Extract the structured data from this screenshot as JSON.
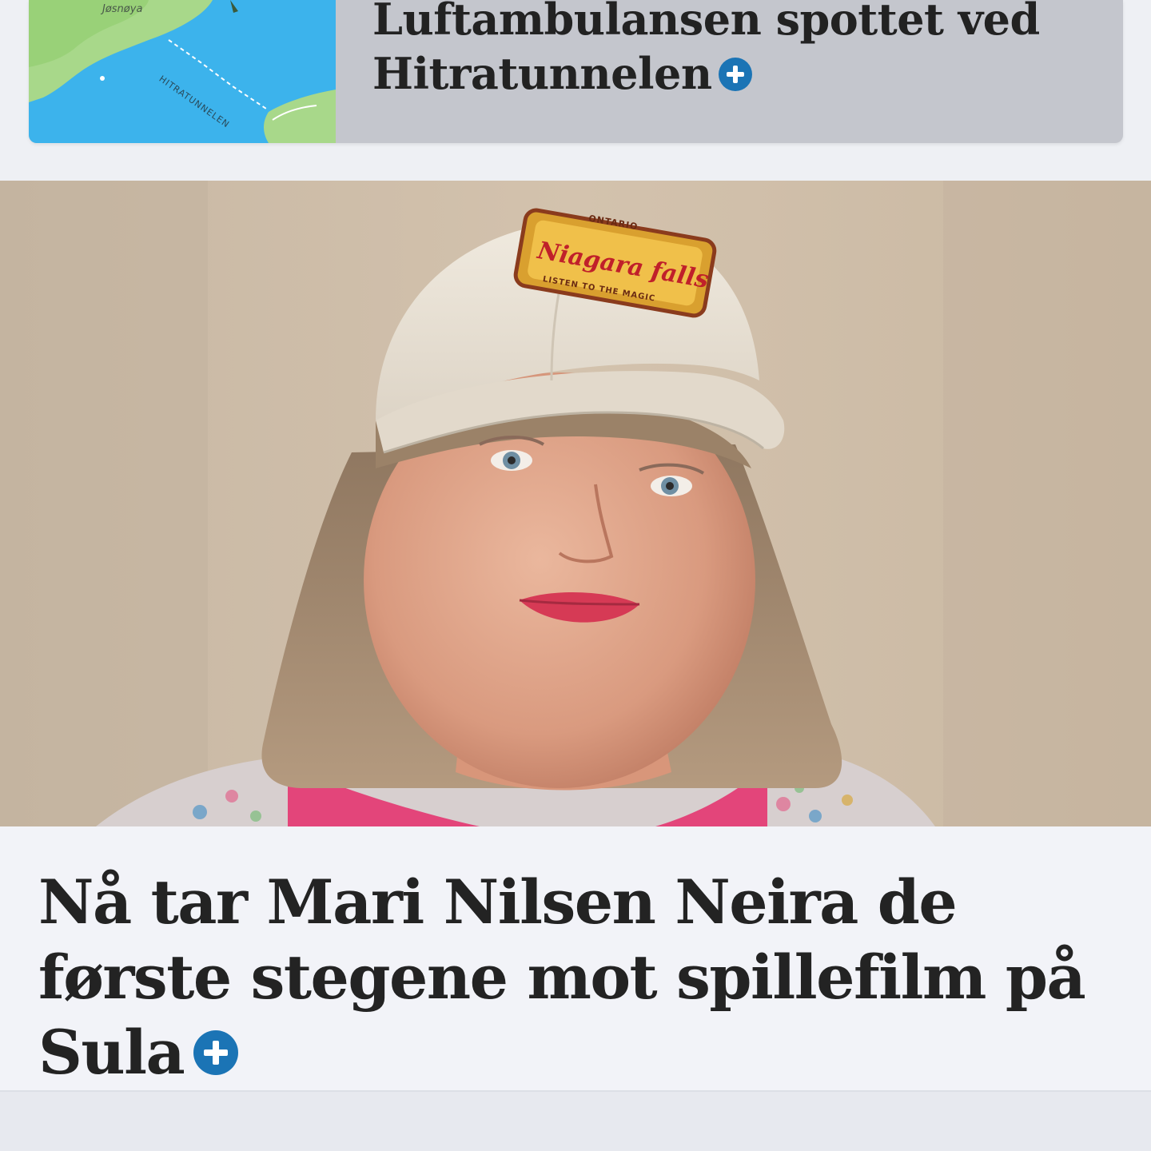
{
  "teaser": {
    "map": {
      "island_label": "Jøsnøya",
      "tunnel_label": "HITRATUNNELEN"
    },
    "headline": "Luftambulansen spottet ved Hitratunnelen",
    "badge": "plus-icon"
  },
  "article": {
    "photo": {
      "cap_patch_top": "ONTARIO",
      "cap_patch_main": "Niagara falls",
      "cap_patch_sub": "LISTEN TO THE MAGIC"
    },
    "headline": "Nå tar Mari Nilsen Neira de første stegene mot spillefilm på Sula",
    "badge": "plus-icon"
  },
  "colors": {
    "badge_blue": "#1b74b5",
    "teaser_bg": "#c4c6cd",
    "article_bg": "#f2f3f8",
    "headline_text": "#232323"
  }
}
